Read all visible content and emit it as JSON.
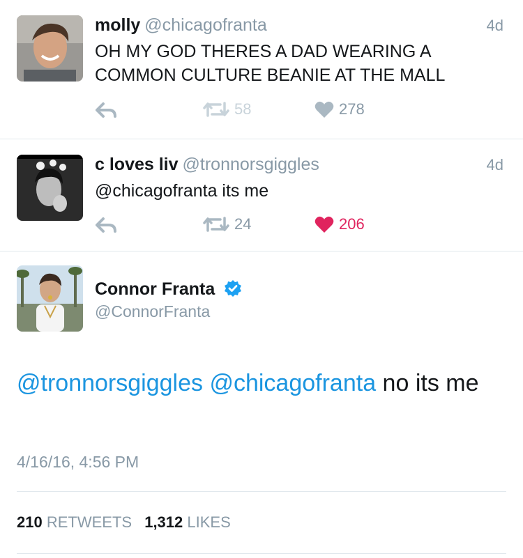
{
  "tweets": [
    {
      "name": "molly",
      "handle": "@chicagofranta",
      "time": "4d",
      "text": "OH MY GOD THERES A DAD WEARING A COMMON CULTURE BEANIE AT THE MALL",
      "retweets": "58",
      "likes": "278",
      "liked": false
    },
    {
      "name": "c loves liv",
      "handle": "@tronnorsgiggles",
      "time": "4d",
      "text": "@chicagofranta its me",
      "retweets": "24",
      "likes": "206",
      "liked": true
    }
  ],
  "main": {
    "name": "Connor Franta",
    "handle": "@ConnorFranta",
    "verified": true,
    "mention1": "@tronnorsgiggles",
    "mention2": "@chicagofranta",
    "text_rest": " no its me",
    "timestamp": "4/16/16, 4:56 PM",
    "retweet_count": "210",
    "retweets_label": "RETWEETS",
    "like_count": "1,312",
    "likes_label": "LIKES"
  },
  "colors": {
    "link": "#1b95e0",
    "muted": "#8899a6",
    "icon": "#aab8c2",
    "liked": "#e0245e",
    "verified": "#1da1f2"
  }
}
